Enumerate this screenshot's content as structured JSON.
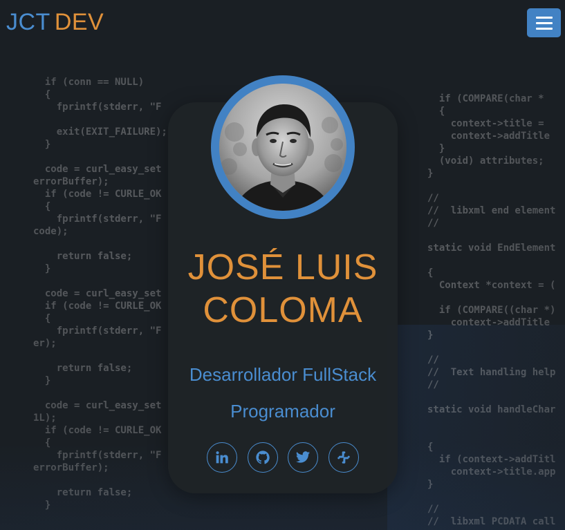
{
  "header": {
    "brand_part1": "JCT",
    "brand_part2": "DEV",
    "menu_icon": "hamburger-menu-icon"
  },
  "profile": {
    "avatar_alt": "Foto de perfil",
    "name_line1": "JOSÉ LUIS",
    "name_line2": "COLOMA",
    "role_1": "Desarrollador FullStack",
    "role_2": "Programador"
  },
  "socials": [
    {
      "icon": "linkedin-icon"
    },
    {
      "icon": "github-icon"
    },
    {
      "icon": "twitter-icon"
    },
    {
      "icon": "slack-icon"
    }
  ],
  "background_code": {
    "left": [
      "",
      "  if (conn == NULL)",
      "  {",
      "    fprintf(stderr, \"F",
      "",
      "    exit(EXIT_FAILURE);",
      "  }",
      "",
      "  code = curl_easy_set",
      "errorBuffer);",
      "  if (code != CURLE_OK",
      "  {",
      "    fprintf(stderr, \"F",
      "code);",
      "",
      "    return false;",
      "  }",
      "",
      "  code = curl_easy_set",
      "  if (code != CURLE_OK",
      "  {",
      "    fprintf(stderr, \"F",
      "er);",
      "",
      "    return false;",
      "  }",
      "",
      "  code = curl_easy_set",
      "1L);",
      "  if (code != CURLE_OK",
      "  {",
      "    fprintf(stderr, \"F",
      "errorBuffer);",
      "",
      "    return false;",
      "  }"
    ],
    "right": [
      "",
      "",
      "  if (COMPARE(char *",
      "  {",
      "    context->title = ",
      "    context->addTitle",
      "  }",
      "  (void) attributes;",
      "}",
      "",
      "//",
      "//  libxml end element",
      "//",
      "",
      "static void EndElement",
      "",
      "{",
      "  Context *context = (",
      "",
      "  if (COMPARE((char *)",
      "    context->addTitle",
      "}",
      "",
      "//",
      "//  Text handling help",
      "//",
      "",
      "static void handleChar",
      "",
      "",
      "{",
      "  if (context->addTitl",
      "    context->title.app",
      "}",
      "",
      "//",
      "//  libxml PCDATA call"
    ]
  },
  "colors": {
    "accent_blue": "#4282c4",
    "accent_orange": "#e0913a",
    "card_bg": "#1e2327"
  }
}
